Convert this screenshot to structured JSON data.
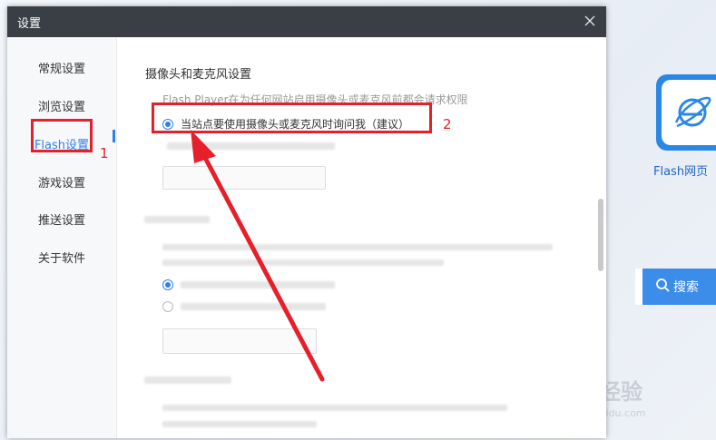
{
  "background": {
    "tile_label": "Flash网页",
    "search_button_label": "搜索",
    "watermark": "Baidu经验",
    "watermark_sub": "jingyan.baidu.com"
  },
  "dialog": {
    "title": "设置",
    "sidebar": {
      "items": [
        {
          "label": "常规设置"
        },
        {
          "label": "浏览设置"
        },
        {
          "label": "Flash设置",
          "active": true
        },
        {
          "label": "游戏设置"
        },
        {
          "label": "推送设置"
        },
        {
          "label": "关于软件"
        }
      ]
    },
    "content": {
      "section_title": "摄像头和麦克风设置",
      "description": "Flash Player在为任何网站启用摄像头或麦克风前都会请求权限",
      "option_selected_label": "当站点要使用摄像头或麦克风时询问我（建议）",
      "option_selected": true
    }
  },
  "annotations": {
    "step1": "1",
    "step2": "2",
    "color": "#e5202a"
  },
  "colors": {
    "accent": "#2f7fe8",
    "titlebar": "#3a3f45"
  }
}
